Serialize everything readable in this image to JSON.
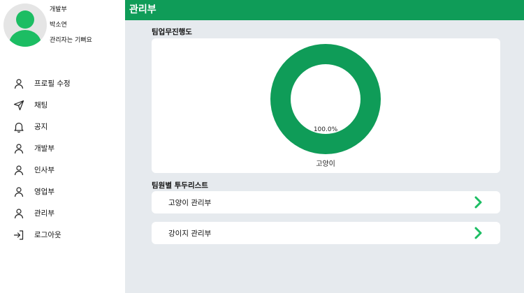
{
  "profile": {
    "department": "개발부",
    "name": "박소연",
    "status": "관리자는 기뻐요"
  },
  "sidebar": {
    "items": [
      {
        "label": "프로필 수정",
        "icon": "user-icon"
      },
      {
        "label": "채팅",
        "icon": "send-icon"
      },
      {
        "label": "공지",
        "icon": "bell-icon"
      },
      {
        "label": "개발부",
        "icon": "user-icon"
      },
      {
        "label": "인사부",
        "icon": "user-icon"
      },
      {
        "label": "영업부",
        "icon": "user-icon"
      },
      {
        "label": "관리부",
        "icon": "user-icon"
      },
      {
        "label": "로그아웃",
        "icon": "logout-icon"
      }
    ]
  },
  "header": {
    "title": "관리부"
  },
  "progress_section": {
    "title": "팀업무진행도"
  },
  "chart_data": {
    "type": "pie",
    "categories": [
      "고양이"
    ],
    "values": [
      100.0
    ],
    "data_labels": [
      "100.0%"
    ],
    "colors": [
      "#0f9c58"
    ]
  },
  "todo_section": {
    "title": "팀원별 투두리스트",
    "items": [
      {
        "label": "고양이 관리부"
      },
      {
        "label": "강이지 관리부"
      }
    ]
  },
  "colors": {
    "accent": "#0f9c58",
    "avatar": "#1cbd63",
    "background": "#e6eaee"
  }
}
